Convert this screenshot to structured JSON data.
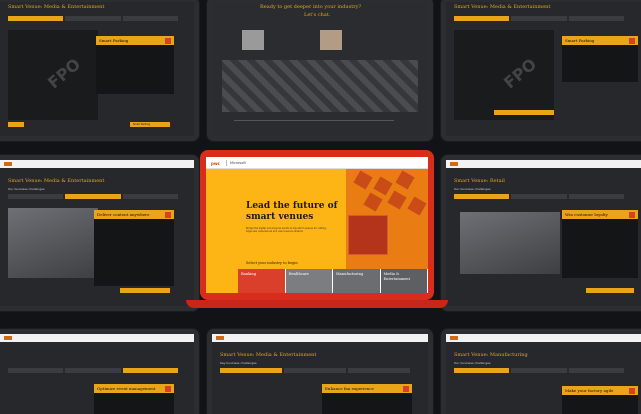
{
  "screens": {
    "top_left": {
      "title": "Smart Venue: Media & Entertainment",
      "card_title": "Smart Parking",
      "fpo": "FPO",
      "button": "Smart Parking"
    },
    "top_center": {
      "heading_line1": "Ready to get deeper into your industry?",
      "heading_line2": "Let's chat."
    },
    "top_right": {
      "title": "Smart Venue: Media & Entertainment",
      "card_title": "Smart Parking",
      "fpo": "FPO"
    },
    "mid_left": {
      "title": "Smart Venue: Media & Entertainment",
      "subtitle": "Our business challenges",
      "card_title": "Deliver content anywhere"
    },
    "mid_right": {
      "title": "Smart Venue: Retail",
      "subtitle": "Our business challenges",
      "card_title": "Win customer loyalty"
    },
    "bottom_left": {
      "card_title": "Optimize event management"
    },
    "bottom_center": {
      "title": "Smart Venue: Media & Entertainment",
      "subtitle": "Key business challenges",
      "card_title": "Enhance fan experience"
    },
    "bottom_right": {
      "title": "Smart Venue: Manufacturing",
      "subtitle": "Our business challenges",
      "card_title": "Make your factory agile"
    }
  },
  "laptop": {
    "brand": "pwc",
    "partner": "Microsoft",
    "headline": "Lead the future of smart venues",
    "body": "Bridge the digital and physical worlds to transform spaces for cutting-edge user experiences and new revenue streams",
    "select_prompt": "Select your industry to begin",
    "industries": [
      "Banking",
      "Healthcare",
      "Manufacturing",
      "Media & Entertainment"
    ]
  },
  "colors": {
    "accent": "#e9a51a",
    "laptop_red": "#d82d1d",
    "screen_yellow": "#fcb515"
  }
}
